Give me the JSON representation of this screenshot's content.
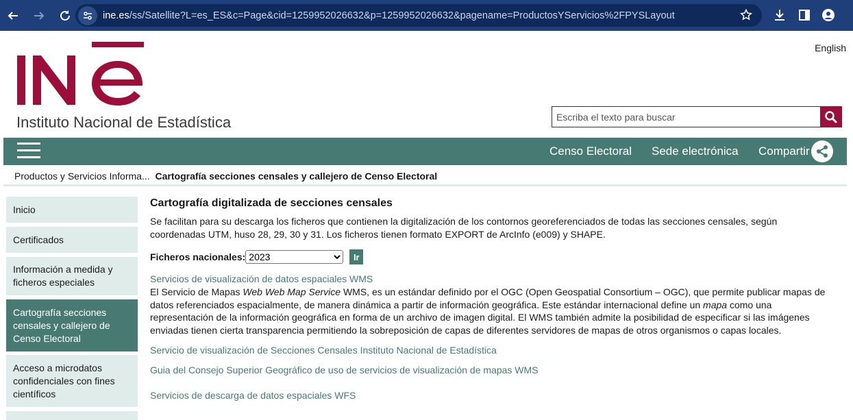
{
  "browser": {
    "url_domain": "ine.es",
    "url_path": "/ss/Satellite?L=es_ES&c=Page&cid=1259952026632&p=1259952026632&pagename=ProductosYServicios%2FPYSLayout"
  },
  "header": {
    "institute_name": "Instituto Nacional de Estadística",
    "language_link": "English",
    "search_placeholder": "Escriba el texto para buscar",
    "brand_color": "#9c0f3b"
  },
  "navbar": {
    "color": "#477a72",
    "links": [
      "Censo Electoral",
      "Sede electrónica",
      "Compartir"
    ]
  },
  "breadcrumb": {
    "parent": "Productos y Servicios Informa...",
    "current": "Cartografía secciones censales y callejero de Censo Electoral"
  },
  "sidebar": {
    "items": [
      {
        "label": "Inicio"
      },
      {
        "label": "Certificados"
      },
      {
        "label": "Información a medida y ficheros especiales"
      },
      {
        "label": "Cartografía secciones censales y callejero de Censo Electoral",
        "active": true
      },
      {
        "label": "Acceso a microdatos confidenciales con fines científicos"
      }
    ]
  },
  "main": {
    "title": "Cartografía digitalizada de secciones censales",
    "intro": "Se facilitan para su descarga los ficheros que contienen la digitalización de los contornos georeferenciados de todas las secciones censales, según coordenadas UTM, huso 28, 29, 30 y 31. Los ficheros tienen formato EXPORT de ArcInfo (e009) y SHAPE.",
    "ficheros_label": "Ficheros nacionales:",
    "year_selected": "2023",
    "go_button": "Ir",
    "wms_link": "Servicios de visualización de datos espaciales WMS",
    "wms_text_1": "El Servicio de Mapas ",
    "wms_text_em": "Web Web Map Service",
    "wms_text_2": " WMS, es un estándar definido por el OGC (Open Geospatial Consortium – OGC), que permite publicar mapas de datos referenciados espacialmente, de manera dinámica a partir de información geográfica. Este estándar internacional define un ",
    "wms_text_em2": "mapa",
    "wms_text_3": " como una representación de la información geográfica en forma de un archivo de imagen digital. El WMS también admite la posibilidad de especificar si las imágenes enviadas tienen cierta transparencia permitiendo la sobreposición de capas de diferentes servidores de mapas de otros organismos o capas locales.",
    "link_secciones": "Servicio de visualización de Secciones Censales Instituto Nacional de Estadística",
    "link_guia": "Guia del Consejo Superior Geográfico de uso de servicios de visualización de mapas WMS",
    "wfs_link": "Servicios de descarga de datos espaciales WFS"
  }
}
